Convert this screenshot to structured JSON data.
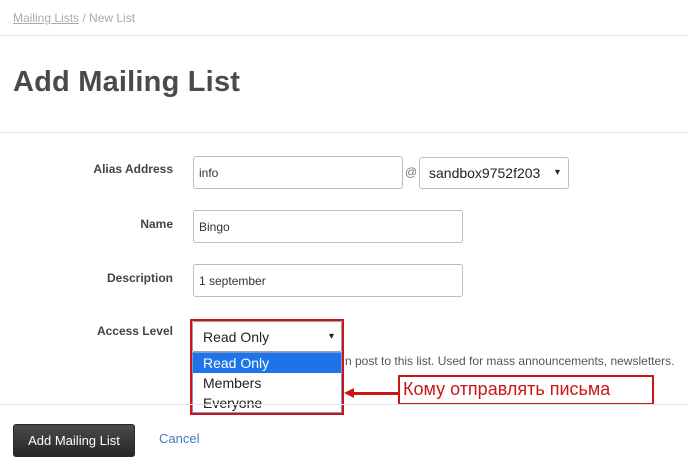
{
  "breadcrumb": {
    "parent": "Mailing Lists",
    "separator": " / ",
    "current": "New List"
  },
  "page_title": "Add Mailing List",
  "form": {
    "alias": {
      "label": "Alias Address",
      "value": "info",
      "at": "@",
      "domain": "sandbox9752f203",
      "domain_arrow": "▾"
    },
    "name": {
      "label": "Name",
      "value": "Bingo"
    },
    "description": {
      "label": "Description",
      "value": "1 september"
    },
    "access": {
      "label": "Access Level",
      "selected": "Read Only",
      "arrow": "▾",
      "options": [
        "Read Only",
        "Members",
        "Everyone"
      ],
      "hint": "n post to this list. Used for mass announcements, newsletters."
    }
  },
  "annotation": {
    "text": "Кому отправлять письма",
    "color": "#cc1616"
  },
  "actions": {
    "submit": "Add Mailing List",
    "cancel": "Cancel"
  },
  "colors": {
    "accent": "#cc1616",
    "highlight": "#1e73e8",
    "link": "#3a7bbf"
  }
}
